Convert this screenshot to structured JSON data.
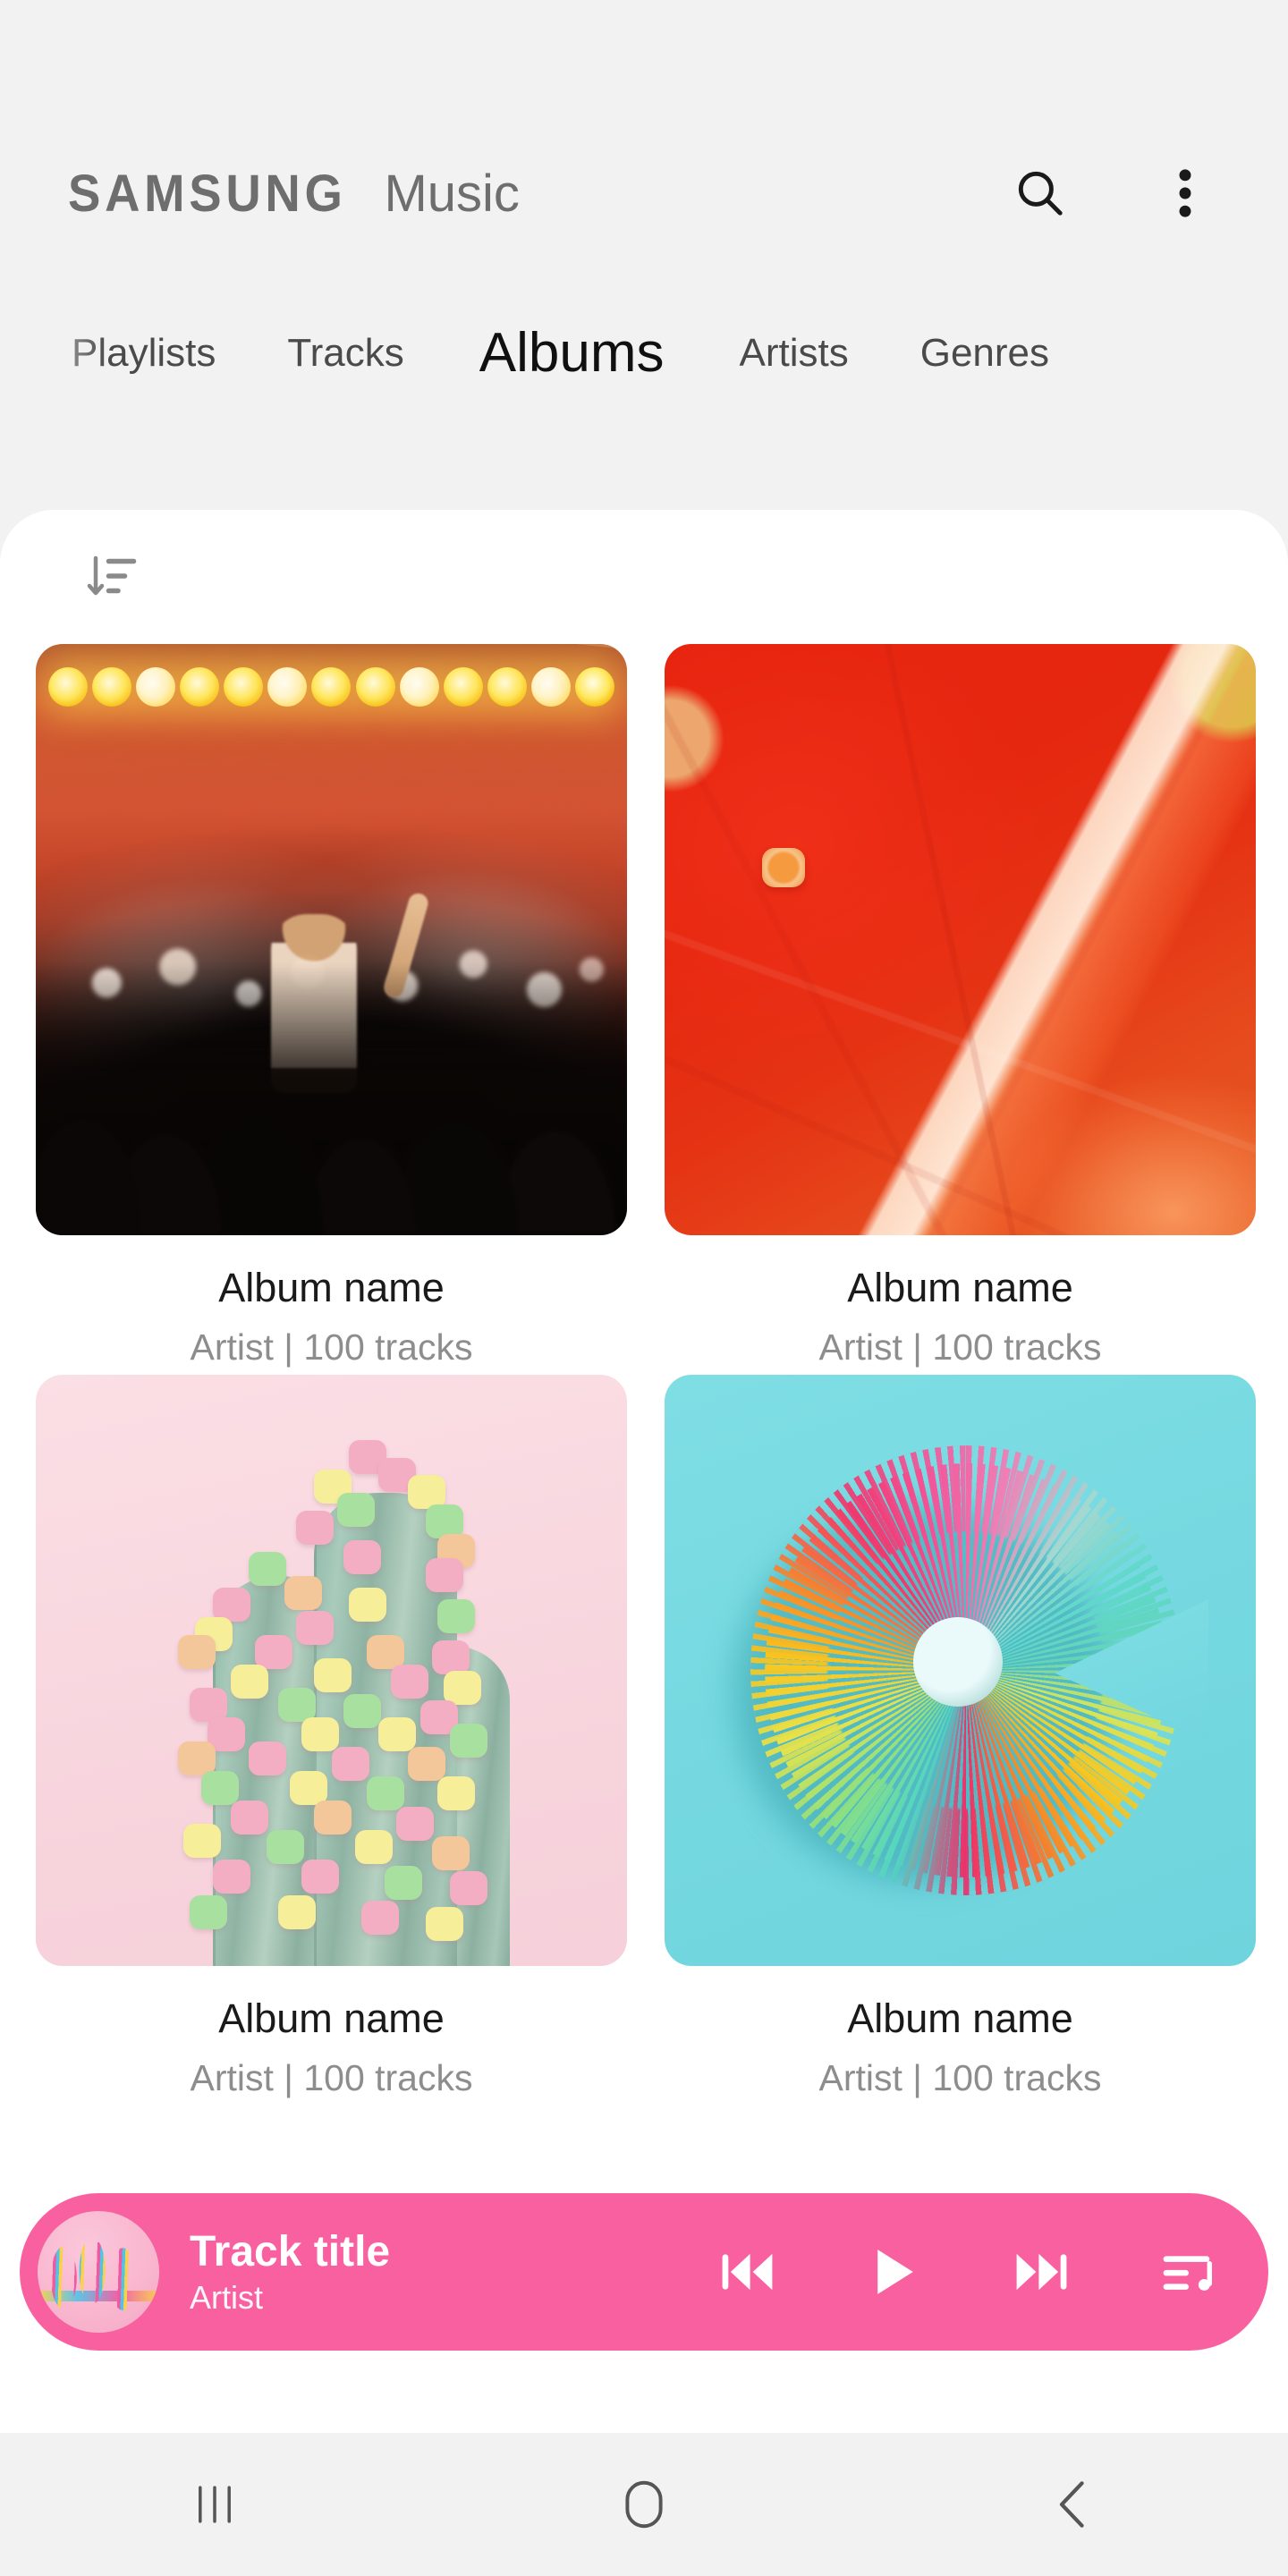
{
  "app": {
    "brand_primary": "SAMSUNG",
    "brand_secondary": "Music",
    "accent_color": "#f9609f",
    "background_color": "#f2f2f2",
    "card_color": "#ffffff"
  },
  "header": {
    "search_icon": "search-icon",
    "more_icon": "more-vertical-icon"
  },
  "tabs": [
    {
      "label": "Playlists",
      "active": false
    },
    {
      "label": "Tracks",
      "active": false
    },
    {
      "label": "Albums",
      "active": true
    },
    {
      "label": "Artists",
      "active": false
    },
    {
      "label": "Genres",
      "active": false
    }
  ],
  "toolbar": {
    "sort_icon": "sort-descending-icon"
  },
  "albums": [
    {
      "title": "Album name",
      "subtitle": "Artist | 100 tracks",
      "artwork": "concert-crowd-stage-lights"
    },
    {
      "title": "Album name",
      "subtitle": "Artist | 100 tracks",
      "artwork": "red-orange-abstract-paint"
    },
    {
      "title": "Album name",
      "subtitle": "Artist | 100 tracks",
      "artwork": "pastel-marshmallow-cactus"
    },
    {
      "title": "Album name",
      "subtitle": "Artist | 100 tracks",
      "artwork": "rainbow-slinky-spring"
    }
  ],
  "mini_player": {
    "track_title": "Track title",
    "artist": "Artist",
    "thumbnail": "colorful-paper-ribbons",
    "controls": [
      {
        "name": "previous-button",
        "icon": "skip-previous-icon"
      },
      {
        "name": "play-button",
        "icon": "play-icon"
      },
      {
        "name": "next-button",
        "icon": "skip-next-icon"
      },
      {
        "name": "queue-button",
        "icon": "playlist-music-icon"
      }
    ]
  },
  "nav_bar": {
    "recents_icon": "recents-icon",
    "home_icon": "home-icon",
    "back_icon": "back-icon"
  }
}
